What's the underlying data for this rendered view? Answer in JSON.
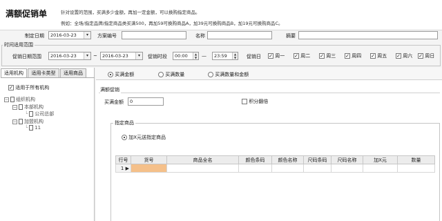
{
  "header": {
    "title": "满额促销单",
    "desc1": "针对设置的范围，买满多少金额，再加一定金额，可以换购指定商品。",
    "desc2": "例如：全场/指定品牌/指定商品类买满500，再加59可换购商品A，加39元可换购商品B，加19元可换购商品C。"
  },
  "form": {
    "date_label": "制定日期",
    "date_value": "2016-03-23",
    "plan_no_label": "方案编号",
    "plan_no_value": "",
    "name_label": "名称",
    "name_value": "",
    "summary_label": "摘要",
    "summary_value": ""
  },
  "time_range": {
    "legend": "时间适用范围",
    "period_label": "促销日期范围",
    "start_date": "2016-03-23",
    "tilde": "~",
    "end_date": "2016-03-23",
    "time_label": "促销时段",
    "start_time": "00:00",
    "dash": "—",
    "end_time": "23:59",
    "day_label": "促销日",
    "days": [
      {
        "label": "周一",
        "checked": true
      },
      {
        "label": "周二",
        "checked": true
      },
      {
        "label": "周三",
        "checked": true
      },
      {
        "label": "周四",
        "checked": true
      },
      {
        "label": "周五",
        "checked": true
      },
      {
        "label": "周六",
        "checked": true
      },
      {
        "label": "周日",
        "checked": true
      }
    ],
    "check_mark": "✓"
  },
  "left_tabs": [
    {
      "label": "适用机构",
      "active": true
    },
    {
      "label": "适用卡类型",
      "active": false
    },
    {
      "label": "适用商品",
      "active": false
    }
  ],
  "left": {
    "all_orgs_label": "适用于所有机构",
    "tree": {
      "root": "组织机构",
      "hq": "本部机构",
      "hq_child": "公司总部",
      "franchise": "加盟机构",
      "franchise_child": "11"
    },
    "minus": "−"
  },
  "promo_type": {
    "options": [
      {
        "label": "买满金额",
        "selected": true
      },
      {
        "label": "买满数量",
        "selected": false
      },
      {
        "label": "买满数量和金额",
        "selected": false
      }
    ]
  },
  "full_promo": {
    "legend": "满额促销",
    "amount_label": "买满金额",
    "amount_value": "0",
    "points_label": "积分翻倍",
    "points_checked": false
  },
  "specified": {
    "legend": "指定商品",
    "radio_label": "加X元送指定商品"
  },
  "grid": {
    "columns": [
      "行号",
      "货号",
      "商品全名",
      "颜色条码",
      "颜色名称",
      "尺码条码",
      "尺码名称",
      "加X元",
      "数量"
    ],
    "rows": [
      {
        "row_no": "1",
        "indicator": "▶",
        "cells": [
          "",
          "",
          "",
          "",
          "",
          "",
          "",
          ""
        ]
      }
    ]
  },
  "colors": {
    "selected_cell": "#f5c08a"
  }
}
